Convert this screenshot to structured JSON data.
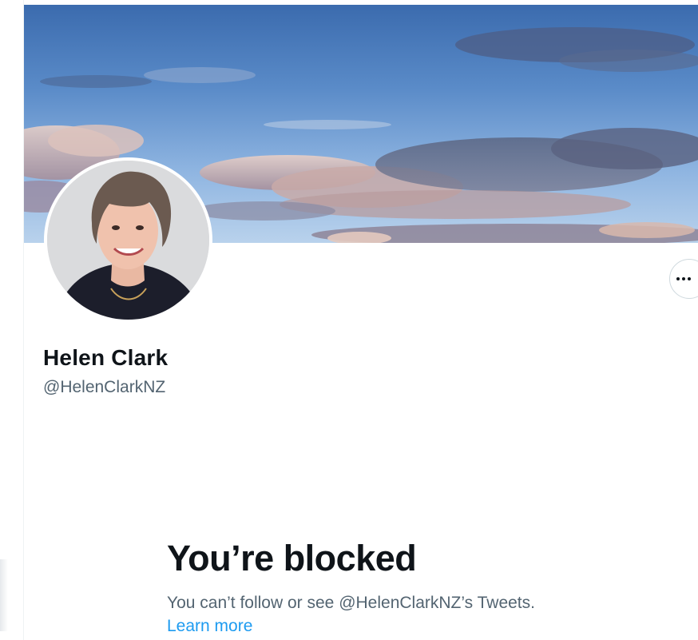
{
  "profile": {
    "display_name": "Helen Clark",
    "handle": "@HelenClarkNZ"
  },
  "header": {
    "banner_description": "sky-clouds-banner",
    "avatar_description": "profile-photo"
  },
  "actions": {
    "more_icon": "ellipsis-horizontal-icon"
  },
  "blocked": {
    "title": "You’re blocked",
    "description": "You can’t follow or see @HelenClarkNZ’s Tweets.",
    "learn_more": "Learn more"
  },
  "colors": {
    "text_primary": "#0f1419",
    "text_secondary": "#536471",
    "link": "#1d9bf0",
    "border": "#cfd9de"
  }
}
